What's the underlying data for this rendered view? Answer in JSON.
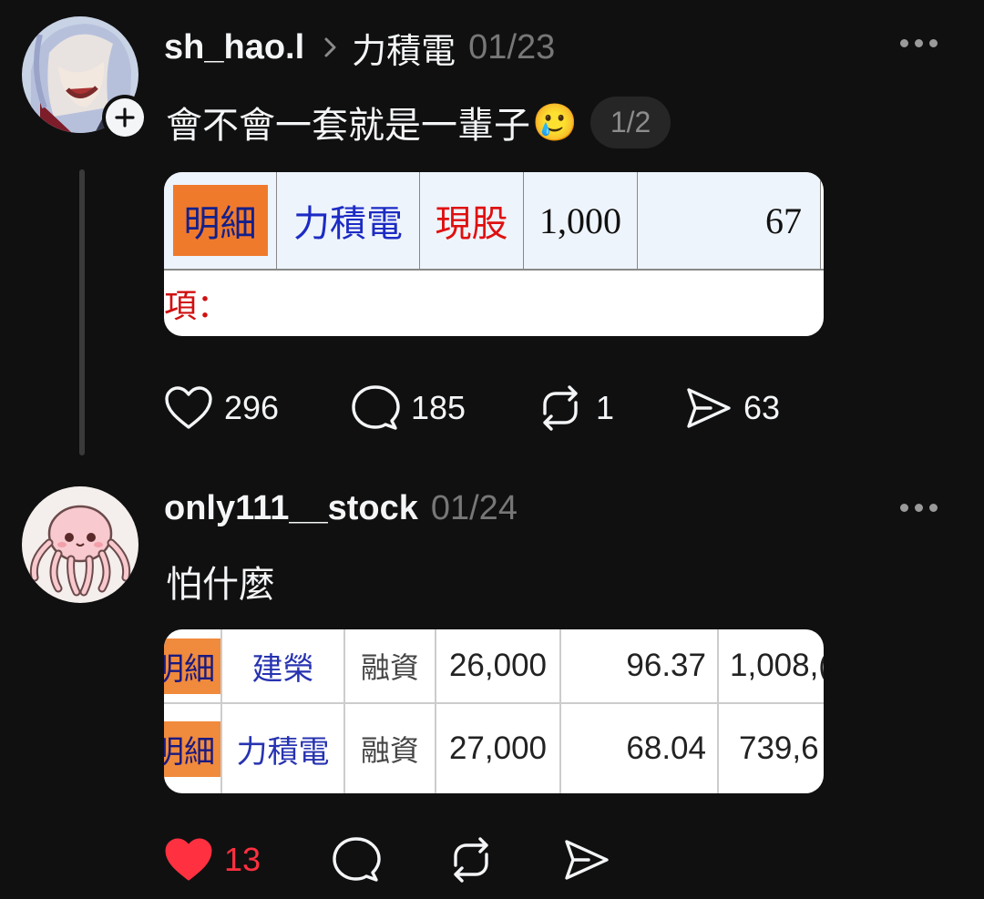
{
  "posts": [
    {
      "username": "sh_hao.l",
      "topic": "力積電",
      "date": "01/23",
      "text": "會不會一套就是一輩子",
      "emoji": "🥲",
      "page_indicator": "1/2",
      "media": {
        "row": [
          "明細",
          "力積電",
          "現股",
          "1,000",
          "67"
        ],
        "note": "項："
      },
      "stats": {
        "likes": "296",
        "replies": "185",
        "reposts": "1",
        "shares": "63"
      },
      "liked": false
    },
    {
      "username": "only111__stock",
      "date": "01/24",
      "text": "怕什麼",
      "media": {
        "rows": [
          [
            "明細",
            "建榮",
            "融資",
            "26,000",
            "96.37",
            "1,008,("
          ],
          [
            "明細",
            "力積電",
            "融資",
            "27,000",
            "68.04",
            "739,6"
          ]
        ]
      },
      "stats": {
        "likes": "13"
      },
      "liked": true
    }
  ],
  "colors": {
    "background": "#101010",
    "text": "#f3f5f7",
    "muted": "#777777",
    "like": "#ff3040"
  },
  "icons": [
    "plus-icon",
    "chevron-right-icon",
    "more-icon",
    "heart-icon",
    "comment-icon",
    "repost-icon",
    "share-icon"
  ]
}
